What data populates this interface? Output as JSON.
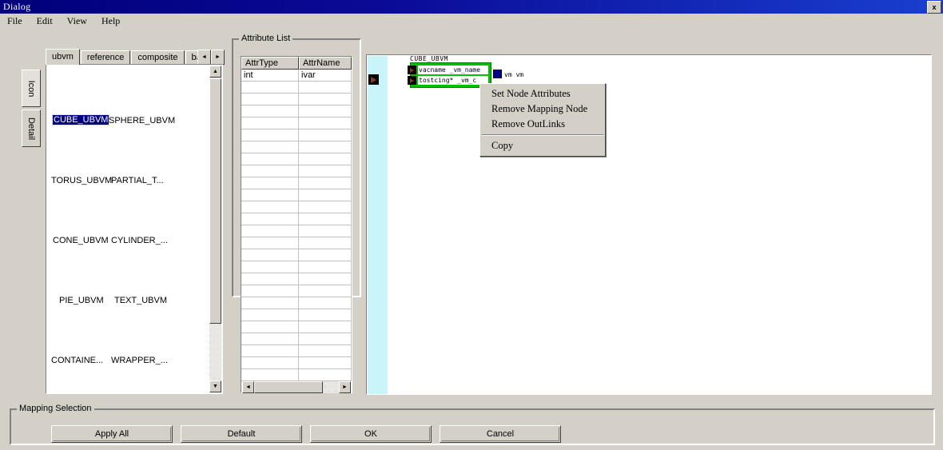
{
  "window": {
    "title": "Dialog",
    "close_label": "x"
  },
  "menubar": {
    "items": [
      {
        "label": "File"
      },
      {
        "label": "Edit"
      },
      {
        "label": "View"
      },
      {
        "label": "Help"
      }
    ]
  },
  "vertical_tabs": [
    {
      "label": "Icon",
      "selected": true
    },
    {
      "label": "Detail",
      "selected": false
    }
  ],
  "palette": {
    "tabs": [
      {
        "label": "ubvm",
        "selected": true
      },
      {
        "label": "reference",
        "selected": false
      },
      {
        "label": "composite",
        "selected": false
      },
      {
        "label": "basic",
        "selected": false
      }
    ],
    "tab_scroll_left": "◄",
    "tab_scroll_right": "►",
    "items": [
      {
        "label": "CUBE_UBVM",
        "selected": true
      },
      {
        "label": "SPHERE_UBVM",
        "selected": false
      },
      {
        "label": "TORUS_UBVM",
        "selected": false
      },
      {
        "label": "PARTIAL_T...",
        "selected": false
      },
      {
        "label": "CONE_UBVM",
        "selected": false
      },
      {
        "label": "CYLINDER_...",
        "selected": false
      },
      {
        "label": "PIE_UBVM",
        "selected": false
      },
      {
        "label": "TEXT_UBVM",
        "selected": false
      },
      {
        "label": "CONTAINE...",
        "selected": false
      },
      {
        "label": "WRAPPER_...",
        "selected": false
      }
    ],
    "scroll_up": "▲",
    "scroll_down": "▼"
  },
  "attribute_list": {
    "title": "Attribute List",
    "columns": [
      "AttrType",
      "AttrName"
    ],
    "rows": [
      [
        "int",
        "ivar"
      ]
    ],
    "scroll_left": "◄",
    "scroll_right": "►"
  },
  "canvas": {
    "node": {
      "title": "CUBE_UBVM",
      "rows": [
        {
          "text": "vacname  _vm_name"
        },
        {
          "text": "tostcing*  _vm_c"
        }
      ],
      "out_label": "vm  vm"
    }
  },
  "context_menu": {
    "items": [
      {
        "label": "Set Node Attributes",
        "separator_after": false
      },
      {
        "label": "Remove Mapping Node",
        "separator_after": false
      },
      {
        "label": "Remove OutLinks",
        "separator_after": true
      },
      {
        "label": "Copy",
        "separator_after": false
      }
    ]
  },
  "mapping_selection": {
    "title": "Mapping Selection",
    "buttons": [
      {
        "label": "Apply All"
      },
      {
        "label": "Default"
      },
      {
        "label": "OK"
      },
      {
        "label": "Cancel"
      }
    ]
  },
  "colors": {
    "face": "#d4d0c8",
    "title_bar": "#00007b",
    "selection": "#000080",
    "node_green": "#00c000",
    "canvas_strip": "#c8f4fa",
    "port_blue": "#00008b"
  }
}
